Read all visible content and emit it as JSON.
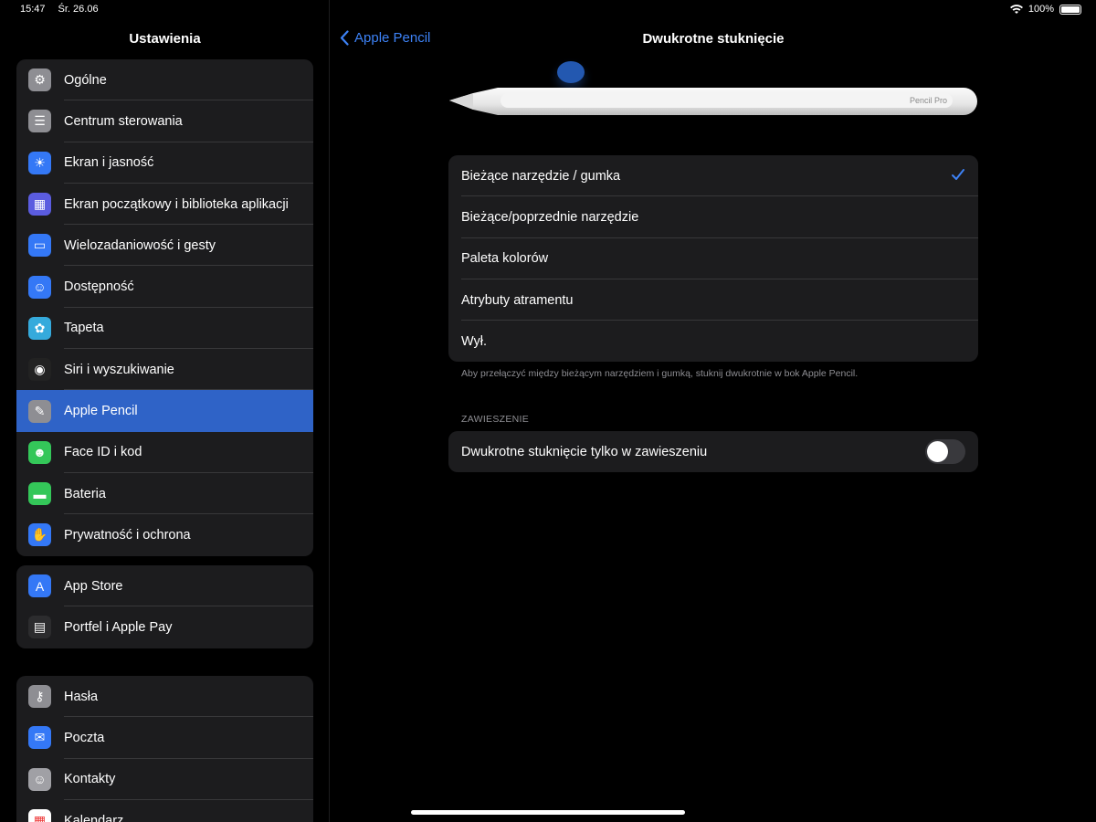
{
  "status": {
    "time": "15:47",
    "date": "Śr. 26.06",
    "battery": "100%"
  },
  "sidebar": {
    "title": "Ustawienia",
    "groups": [
      {
        "items": [
          {
            "label": "Ogólne",
            "icon": "gear-icon",
            "color": "#8e8e93"
          },
          {
            "label": "Centrum sterowania",
            "icon": "switches-icon",
            "color": "#8e8e93"
          },
          {
            "label": "Ekran i jasność",
            "icon": "sun-icon",
            "color": "#3478f6"
          },
          {
            "label": "Ekran początkowy i biblioteka aplikacji",
            "icon": "app-grid-icon",
            "color": "#5b5ce0"
          },
          {
            "label": "Wielozadaniowość i gesty",
            "icon": "multitask-icon",
            "color": "#3478f6"
          },
          {
            "label": "Dostępność",
            "icon": "accessibility-icon",
            "color": "#3478f6"
          },
          {
            "label": "Tapeta",
            "icon": "flower-icon",
            "color": "#35aadc"
          },
          {
            "label": "Siri i wyszukiwanie",
            "icon": "siri-icon",
            "color": "#222"
          },
          {
            "label": "Apple Pencil",
            "icon": "pencil-icon",
            "color": "#8e8e93",
            "selected": true
          },
          {
            "label": "Face ID i kod",
            "icon": "faceid-icon",
            "color": "#34c759"
          },
          {
            "label": "Bateria",
            "icon": "battery-icon",
            "color": "#34c759"
          },
          {
            "label": "Prywatność i ochrona",
            "icon": "hand-icon",
            "color": "#3478f6"
          }
        ]
      },
      {
        "items": [
          {
            "label": "App Store",
            "icon": "appstore-icon",
            "color": "#3478f6"
          },
          {
            "label": "Portfel i Apple Pay",
            "icon": "wallet-icon",
            "color": "#2c2c2e"
          }
        ]
      },
      {
        "items": [
          {
            "label": "Hasła",
            "icon": "key-icon",
            "color": "#8e8e93"
          },
          {
            "label": "Poczta",
            "icon": "mail-icon",
            "color": "#3478f6"
          },
          {
            "label": "Kontakty",
            "icon": "contacts-icon",
            "color": "#a0a0a5"
          },
          {
            "label": "Kalendarz",
            "icon": "calendar-icon",
            "color": "#fff"
          }
        ]
      }
    ]
  },
  "nav": {
    "back_label": "Apple Pencil",
    "title": "Dwukrotne stuknięcie"
  },
  "pencil_brand": "Pencil Pro",
  "options": [
    {
      "label": "Bieżące narzędzie / gumka",
      "checked": true
    },
    {
      "label": "Bieżące/poprzednie narzędzie",
      "checked": false
    },
    {
      "label": "Paleta kolorów",
      "checked": false
    },
    {
      "label": "Atrybuty atramentu",
      "checked": false
    },
    {
      "label": "Wył.",
      "checked": false
    }
  ],
  "options_footer": "Aby przełączyć między bieżącym narzędziem i gumką, stuknij dwukrotnie w bok Apple Pencil.",
  "hover_section": {
    "header": "ZAWIESZENIE",
    "toggle_label": "Dwukrotne stuknięcie tylko w zawieszeniu",
    "toggle_on": false
  },
  "accent": "#3d82f6"
}
